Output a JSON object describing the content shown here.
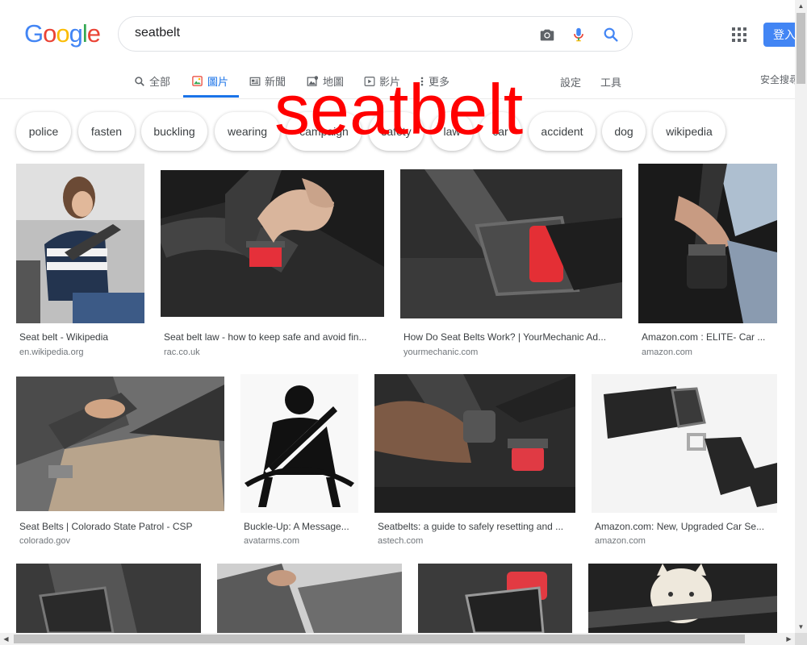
{
  "header": {
    "logo": "Google",
    "search": {
      "value": "seatbelt"
    },
    "login_label": "登入",
    "icons": [
      "camera-icon",
      "microphone-icon",
      "search-icon",
      "apps-icon"
    ]
  },
  "tabs": [
    {
      "label": "全部",
      "icon": "search-icon"
    },
    {
      "label": "圖片",
      "icon": "image-icon"
    },
    {
      "label": "新聞",
      "icon": "news-icon"
    },
    {
      "label": "地圖",
      "icon": "map-icon"
    },
    {
      "label": "影片",
      "icon": "video-icon"
    },
    {
      "label": "更多",
      "icon": "more-icon"
    }
  ],
  "tools": {
    "settings": "設定",
    "tools": "工具",
    "safesearch": "安全搜尋"
  },
  "chips": [
    "police",
    "fasten",
    "buckling",
    "wearing",
    "campaign",
    "safety",
    "law",
    "car",
    "accident",
    "dog",
    "wikipedia"
  ],
  "overlay_text": "seatbelt",
  "results": [
    {
      "title": "Seat belt - Wikipedia",
      "source": "en.wikipedia.org"
    },
    {
      "title": "Seat belt law - how to keep safe and avoid fin...",
      "source": "rac.co.uk"
    },
    {
      "title": "How Do Seat Belts Work? | YourMechanic Ad...",
      "source": "yourmechanic.com"
    },
    {
      "title": "Amazon.com : ELITE- Car ...",
      "source": "amazon.com"
    },
    {
      "title": "Seat Belts | Colorado State Patrol - CSP",
      "source": "colorado.gov"
    },
    {
      "title": "Buckle-Up: A Message...",
      "source": "avatarms.com"
    },
    {
      "title": "Seatbelts: a guide to safely resetting and ...",
      "source": "astech.com"
    },
    {
      "title": "Amazon.com: New, Upgraded Car Se...",
      "source": "amazon.com"
    },
    {
      "title": "",
      "source": ""
    },
    {
      "title": "",
      "source": ""
    },
    {
      "title": "",
      "source": ""
    },
    {
      "title": "",
      "source": ""
    }
  ],
  "colors": {
    "accent": "#1a73e8",
    "overlay": "#ff0000",
    "login_bg": "#4285f4"
  }
}
